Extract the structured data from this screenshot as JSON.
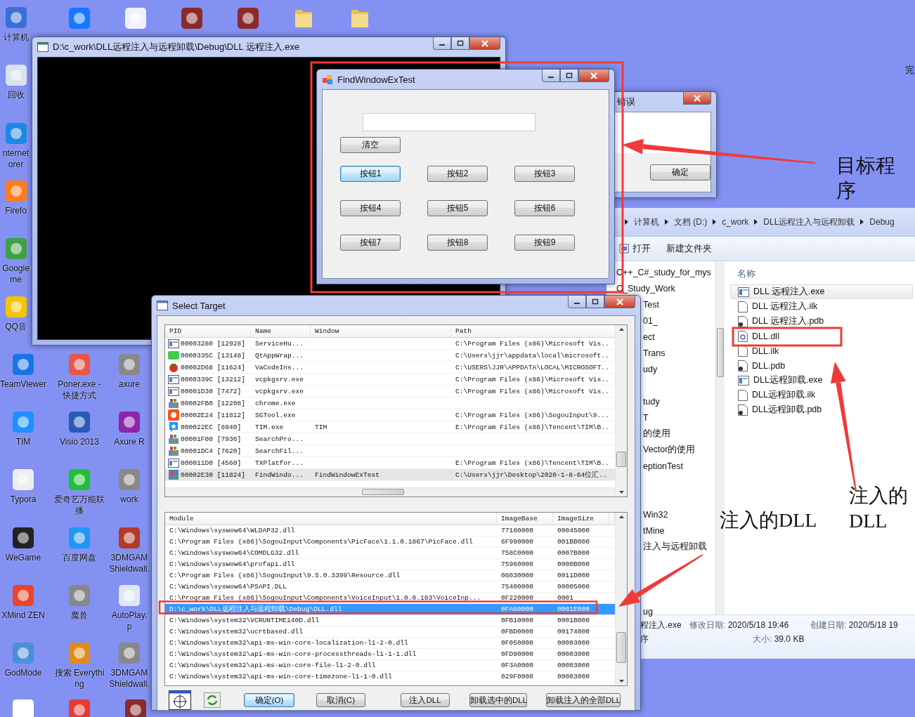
{
  "desktop": {
    "columns": [
      [
        {
          "lines": [
            "计算机"
          ]
        },
        {
          "lines": [
            "回收"
          ]
        },
        {
          "lines": [
            "nternet",
            "orer"
          ]
        },
        {
          "lines": [
            "Firefo"
          ]
        },
        {
          "lines": [
            "Google",
            "me"
          ]
        },
        {
          "lines": [
            "QQ音"
          ]
        },
        {
          "lines": [
            "TeamViewer"
          ]
        },
        {
          "lines": [
            "TIM"
          ]
        },
        {
          "lines": [
            "Typora"
          ]
        },
        {
          "lines": [
            "WeGame"
          ]
        },
        {
          "lines": [
            "XMind ZEN"
          ]
        },
        {
          "lines": [
            "GodMode"
          ]
        }
      ],
      [
        {
          "lines": [
            "Poner.exe -",
            "快捷方式"
          ]
        },
        {
          "lines": [
            "Visio 2013"
          ]
        },
        {
          "lines": [
            "爱奇艺万能联",
            "播"
          ]
        },
        {
          "lines": [
            "百度网盘"
          ]
        },
        {
          "lines": [
            "魔兽"
          ]
        },
        {
          "lines": [
            "搜索 Everythi",
            "ng"
          ]
        }
      ],
      [
        {
          "lines": [
            "axure"
          ]
        },
        {
          "lines": [
            "Axure R"
          ]
        },
        {
          "lines": [
            "work"
          ]
        },
        {
          "lines": [
            "3DMGAM",
            "Shieldwall."
          ]
        },
        {
          "lines": [
            "AutoPlay.",
            "p"
          ]
        },
        {
          "lines": [
            "3DMGAM",
            "Shieldwall."
          ]
        }
      ]
    ],
    "edge_text": "完"
  },
  "console_window": {
    "title": "D:\\c_work\\DLL远程注入与远程卸载\\Debug\\DLL 远程注入.exe"
  },
  "explorer": {
    "breadcrumb": [
      "计算机",
      "文档 (D:)",
      "c_work",
      "DLL远程注入与远程卸载",
      "Debug"
    ],
    "toolbar": [
      "打开",
      "新建文件夹"
    ],
    "nav_items": [
      "C++_C#_study_for_mys",
      "C_Study_Work",
      "Test",
      "01_",
      "ect",
      "Trans",
      "udy",
      "tudy",
      "T",
      "的使用",
      "Vector的使用",
      "eptionTest",
      "Win32",
      "tMine",
      "注入与远程卸载",
      "ug"
    ],
    "column_header": "名称",
    "files": [
      {
        "name": "DLL 远程注入.exe",
        "selected": true
      },
      {
        "name": "DLL 远程注入.ilk",
        "selected": false
      },
      {
        "name": "DLL 远程注入.pdb",
        "selected": false
      },
      {
        "name": "DLL.dll",
        "selected": false
      },
      {
        "name": "DLL.ilk",
        "selected": false
      },
      {
        "name": "DLL.pdb",
        "selected": false
      },
      {
        "name": "DLL远程卸载.exe",
        "selected": false
      },
      {
        "name": "DLL远程卸载.ilk",
        "selected": false
      },
      {
        "name": "DLL远程卸载.pdb",
        "selected": false
      }
    ],
    "status": {
      "file_name": "程注入.exe",
      "file_type": "序",
      "modified": {
        "label": "修改日期:",
        "value": "2020/5/18 19:46"
      },
      "created": {
        "label": "创建日期:",
        "value": "2020/5/18 19"
      },
      "size": {
        "label": "大小:",
        "value": "39.0 KB"
      }
    }
  },
  "error_dialog": {
    "title": "错误",
    "button": "确定"
  },
  "find_window": {
    "title": "FindWindowExTest",
    "clear_button": "清空",
    "buttons": [
      {
        "label": "按钮1",
        "focused": true
      },
      {
        "label": "按钮2",
        "focused": false
      },
      {
        "label": "按钮3",
        "focused": false
      },
      {
        "label": "按钮4",
        "focused": false
      },
      {
        "label": "按钮5",
        "focused": false
      },
      {
        "label": "按钮6",
        "focused": false
      },
      {
        "label": "按钮7",
        "focused": false
      },
      {
        "label": "按钮8",
        "focused": false
      },
      {
        "label": "按钮9",
        "focused": false
      }
    ]
  },
  "select_target": {
    "title": "Select Target",
    "processes": {
      "columns": [
        "PID",
        "Name",
        "Window",
        "Path"
      ],
      "rows": [
        {
          "pid": "00003280 [12928]",
          "name": "ServiceHu...",
          "path": "C:\\Program Files (x86)\\Microsoft Vis..",
          "selected": false
        },
        {
          "pid": "0000335C [13148]",
          "name": "QtAppWrap...",
          "path": "C:\\Users\\jjr\\appdata\\local\\microsoft..",
          "selected": false
        },
        {
          "pid": "00002D68 [11624]",
          "name": "VaCodeIns...",
          "path": "C:\\USERS\\JJR\\APPDATA\\LOCAL\\MICROSOFT..",
          "selected": false
        },
        {
          "pid": "0000339C [13212]",
          "name": "vcpkgsrv.exe",
          "path": "C:\\Program Files (x86)\\Microsoft Vis..",
          "selected": false
        },
        {
          "pid": "00001D30 [7472]",
          "name": "vcpkgsrv.exe",
          "path": "C:\\Program Files (x86)\\Microsoft Vis..",
          "selected": false
        },
        {
          "pid": "00002FB0 [12208]",
          "name": "chrome.exe",
          "selected": false
        },
        {
          "pid": "00002E24 [11812]",
          "name": "SGTool.exe",
          "path": "C:\\Program Files (x86)\\SogouInput\\9...",
          "selected": false
        },
        {
          "pid": "000022EC [8940]",
          "name": "TIM.exe",
          "window": "TIM",
          "path": "E:\\Program Files (x86)\\Tencent\\TIM\\B..",
          "selected": false
        },
        {
          "pid": "00001F00 [7936]",
          "name": "SearchPro...",
          "selected": false
        },
        {
          "pid": "00001DC4 [7620]",
          "name": "SearchFil...",
          "selected": false
        },
        {
          "pid": "000011D0 [4560]",
          "name": "TXPlatfor...",
          "path": "E:\\Program Files (x86)\\Tencent\\TIM\\B..",
          "selected": false
        },
        {
          "pid": "00002E30 [11824]",
          "name": "FindWindo...",
          "window": "FindWindowExTest",
          "path": "C:\\Users\\jjr\\Desktop\\2020-1-8-64位汇..",
          "selected": true
        }
      ]
    },
    "modules": {
      "columns": [
        "Module",
        "ImageBase",
        "ImageSize"
      ],
      "rows": [
        {
          "module": "C:\\Windows\\syswow64\\WLDAP32.dll",
          "base": "77180000",
          "size": "00045000",
          "selected": false
        },
        {
          "module": "C:\\Program Files (x86)\\SogouInput\\Components\\PicFace\\1.1.0.1867\\PicFace.dll",
          "base": "6F990000",
          "size": "001BB000",
          "selected": false
        },
        {
          "module": "C:\\Windows\\syswow64\\COMDLG32.dll",
          "base": "758C0000",
          "size": "0007B000",
          "selected": false
        },
        {
          "module": "C:\\Windows\\syswow64\\profapi.dll",
          "base": "75960000",
          "size": "0000B000",
          "selected": false
        },
        {
          "module": "C:\\Program Files (x86)\\SogouInput\\9.5.0.3399\\Resource.dll",
          "base": "06030000",
          "size": "0011D000",
          "selected": false
        },
        {
          "module": "C:\\Windows\\syswow64\\PSAPI.DLL",
          "base": "75400000",
          "size": "00005000",
          "selected": false
        },
        {
          "module": "C:\\Program Files (x86)\\SogouInput\\Components\\VoiceInput\\1.0.0.183\\VoiceInp...",
          "base": "0F220000",
          "size": "0001",
          "selected": false
        },
        {
          "module": "D:\\c_work\\DLL远程注入与远程卸载\\Debug\\DLL.dll",
          "base": "0FA60000",
          "size": "0001E000",
          "selected": true
        },
        {
          "module": "C:\\Windows\\system32\\VCRUNTIME140D.dll",
          "base": "0FB10000",
          "size": "0001B000",
          "selected": false
        },
        {
          "module": "C:\\Windows\\system32\\ucrtbased.dll",
          "base": "0FBD0000",
          "size": "00174000",
          "selected": false
        },
        {
          "module": "C:\\Windows\\system32\\api-ms-win-core-localization-l1-2-0.dll",
          "base": "0F050000",
          "size": "00003000",
          "selected": false
        },
        {
          "module": "C:\\Windows\\system32\\api-ms-win-core-processthreads-l1-1-1.dll",
          "base": "0FD90000",
          "size": "00003000",
          "selected": false
        },
        {
          "module": "C:\\Windows\\system32\\api-ms-win-core-file-l1-2-0.dll",
          "base": "0F3A0000",
          "size": "00003000",
          "selected": false
        },
        {
          "module": "C:\\Windows\\system32\\api-ms-win-core-timezone-l1-1-0.dll",
          "base": "029F0000",
          "size": "00003000",
          "selected": false
        }
      ]
    },
    "buttons": [
      {
        "label": "确定(O)",
        "focused": true
      },
      {
        "label": "取消(C)",
        "focused": false
      },
      {
        "label": "注入DLL",
        "focused": false
      },
      {
        "label": "卸载选中的DLL",
        "focused": false
      },
      {
        "label": "卸载注入的全部DLL",
        "focused": false
      }
    ]
  },
  "annotations": [
    {
      "text": "目标程序"
    },
    {
      "text": "注入的DLL"
    },
    {
      "text": "注入的 DLL"
    }
  ]
}
